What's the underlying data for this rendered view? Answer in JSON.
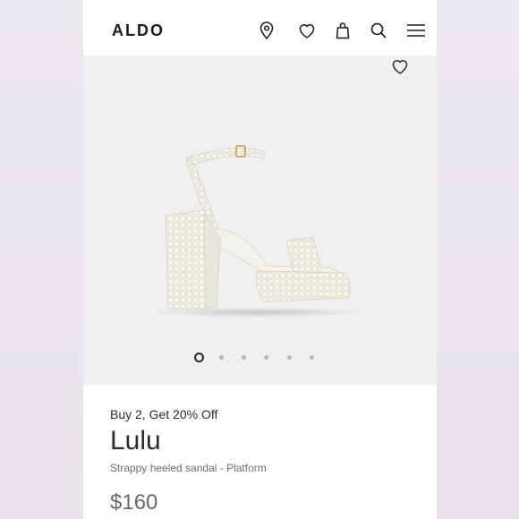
{
  "header": {
    "logo": "ALDO",
    "icons": [
      "location-icon",
      "wishlist-icon",
      "bag-icon",
      "search-icon",
      "menu-icon"
    ]
  },
  "gallery": {
    "image_count": 6,
    "active_index": 0
  },
  "product": {
    "promo": "Buy 2, Get 20% Off",
    "name": "Lulu",
    "description": "Strappy heeled sandal - Platform",
    "price": "$160"
  },
  "colors": {
    "background": "#e9e5ec",
    "hero_background": "#f0eff1",
    "text": "#2b2b2b"
  }
}
